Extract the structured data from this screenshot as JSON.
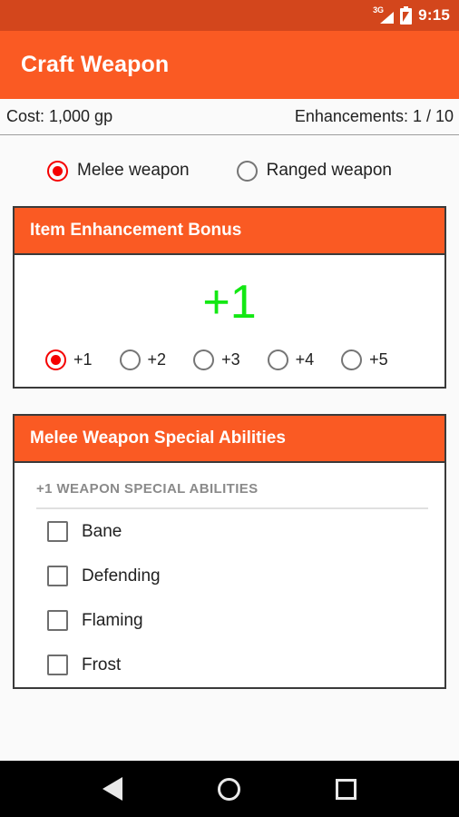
{
  "status_bar": {
    "network_label": "3G",
    "time": "9:15",
    "background_color": "#D3461C",
    "battery_icon": "battery-charging-icon",
    "signal_icon": "signal-3g-icon"
  },
  "app_bar": {
    "title": "Craft Weapon",
    "background_color": "#FA5A23"
  },
  "cost_bar": {
    "cost": "Cost: 1,000 gp",
    "enhancements": "Enhancements: 1 / 10"
  },
  "weapon_type": {
    "options": [
      {
        "label": "Melee weapon",
        "selected": true
      },
      {
        "label": "Ranged weapon",
        "selected": false
      }
    ],
    "selected_color": "#F50000"
  },
  "enhancement_bonus_card": {
    "title": "Item Enhancement Bonus",
    "value": "+1",
    "value_color": "#13E813",
    "options": [
      {
        "label": "+1",
        "selected": true
      },
      {
        "label": "+2",
        "selected": false
      },
      {
        "label": "+3",
        "selected": false
      },
      {
        "label": "+4",
        "selected": false
      },
      {
        "label": "+5",
        "selected": false
      }
    ]
  },
  "special_abilities_card": {
    "title": "Melee Weapon Special Abilities",
    "section_label": "+1 WEAPON SPECIAL ABILITIES",
    "items": [
      {
        "label": "Bane",
        "checked": false
      },
      {
        "label": "Defending",
        "checked": false
      },
      {
        "label": "Flaming",
        "checked": false
      },
      {
        "label": "Frost",
        "checked": false
      }
    ]
  },
  "nav_bar": {
    "back": "back-icon",
    "home": "home-icon",
    "recents": "recents-icon"
  }
}
